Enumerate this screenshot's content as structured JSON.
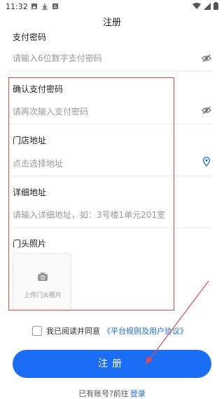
{
  "status_bar": {
    "time": "11:32"
  },
  "header": {
    "title": "注册"
  },
  "form": {
    "pay_password": {
      "label": "支付密码",
      "placeholder": "请输入6位数字支付密码"
    },
    "confirm_pay_password": {
      "label": "确认支付密码",
      "placeholder": "请再次输入支付密码"
    },
    "store_address": {
      "label": "门店地址",
      "placeholder": "点击选择地址"
    },
    "detail_address": {
      "label": "详细地址",
      "placeholder": "请输入详细地址，如：3号楼1单元201室"
    },
    "storefront_photo": {
      "label": "门头照片",
      "upload_label": "上传门头照片"
    }
  },
  "agreement": {
    "text": "我已阅读并同意",
    "link": "《平台规则及用户协议》",
    "checked": false
  },
  "register_button": "注册",
  "login_prompt": {
    "text": "已有账号?前往",
    "link": "登录"
  },
  "colors": {
    "accent": "#1a6ef5",
    "annotation": "#e24a4a"
  }
}
